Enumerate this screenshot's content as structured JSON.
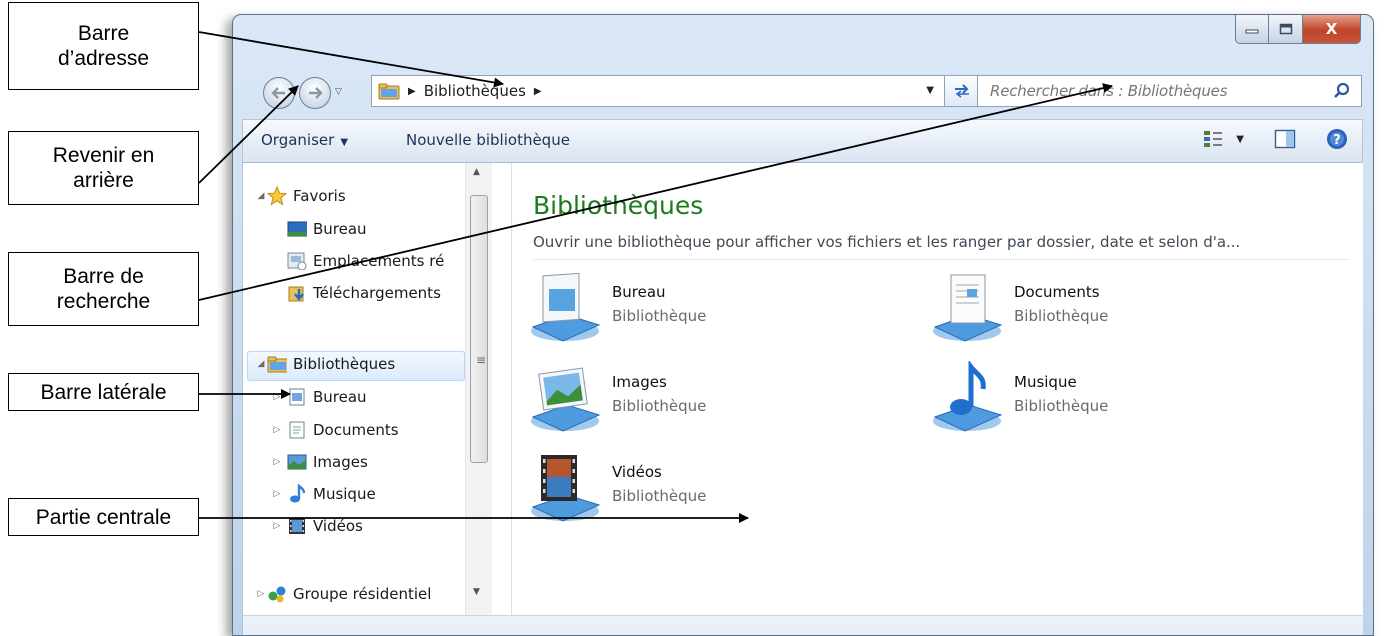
{
  "callouts": {
    "address_bar": [
      "Barre",
      "d’adresse"
    ],
    "back": [
      "Revenir en",
      "arrière"
    ],
    "search": [
      "Barre de",
      "recherche"
    ],
    "sidebar": [
      "Barre latérale"
    ],
    "central": [
      "Partie centrale"
    ]
  },
  "window": {
    "controls": {
      "minimize": "–",
      "maximize": "□",
      "close": "X"
    }
  },
  "address": {
    "crumb": "Bibliothèques",
    "separator": "▶",
    "dropdown": "▼",
    "refresh_icon": "⇄"
  },
  "search": {
    "placeholder": "Rechercher dans : Bibliothèques"
  },
  "toolbar": {
    "organize": "Organiser",
    "new_library": "Nouvelle bibliothèque",
    "caret": "▼"
  },
  "sidebar": {
    "favorites": "Favoris",
    "fav_items": [
      "Bureau",
      "Emplacements ré",
      "Téléchargements"
    ],
    "libraries": "Bibliothèques",
    "lib_items": [
      "Bureau",
      "Documents",
      "Images",
      "Musique",
      "Vidéos"
    ],
    "homegroup": "Groupe résidentiel"
  },
  "content": {
    "title": "Bibliothèques",
    "description": "Ouvrir une bibliothèque pour afficher vos fichiers et les ranger par dossier, date et selon d'a...",
    "tiles": [
      {
        "name": "Bureau",
        "type": "Bibliothèque",
        "icon": "desktop-library-icon"
      },
      {
        "name": "Documents",
        "type": "Bibliothèque",
        "icon": "documents-library-icon"
      },
      {
        "name": "Images",
        "type": "Bibliothèque",
        "icon": "pictures-library-icon"
      },
      {
        "name": "Musique",
        "type": "Bibliothèque",
        "icon": "music-library-icon"
      },
      {
        "name": "Vidéos",
        "type": "Bibliothèque",
        "icon": "videos-library-icon"
      }
    ]
  },
  "colors": {
    "title_green": "#1e7a1e",
    "window_frame": "#c9dcf0",
    "close_red": "#c0442a"
  }
}
